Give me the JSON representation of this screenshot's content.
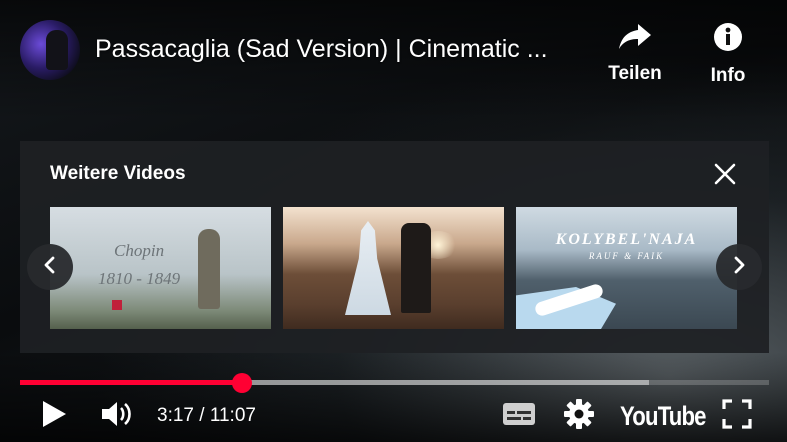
{
  "video": {
    "title": "Passacaglia (Sad Version) | Cinematic ..."
  },
  "top_actions": {
    "share_label": "Teilen",
    "info_label": "Info"
  },
  "more_videos": {
    "heading": "Weitere Videos",
    "thumbnails": [
      {
        "title_line1": "Chopin",
        "title_line2": "1810 - 1849"
      },
      {
        "description": "couple walking in field at sunset"
      },
      {
        "title_line1": "KOLYBEL'NAJA",
        "title_line2": "RAUF & FAIK"
      }
    ]
  },
  "player": {
    "current_time": "3:17",
    "duration": "11:07",
    "time_display": "3:17 / 11:07",
    "played_fraction": 0.296,
    "loaded_fraction": 0.84,
    "logo_text": "YouTube"
  },
  "colors": {
    "accent": "#ff0033",
    "panel_bg": "#1e2023"
  },
  "icons": [
    "share-icon",
    "info-icon",
    "close-icon",
    "chevron-left-icon",
    "chevron-right-icon",
    "play-icon",
    "volume-icon",
    "subtitles-icon",
    "settings-icon",
    "fullscreen-icon"
  ]
}
